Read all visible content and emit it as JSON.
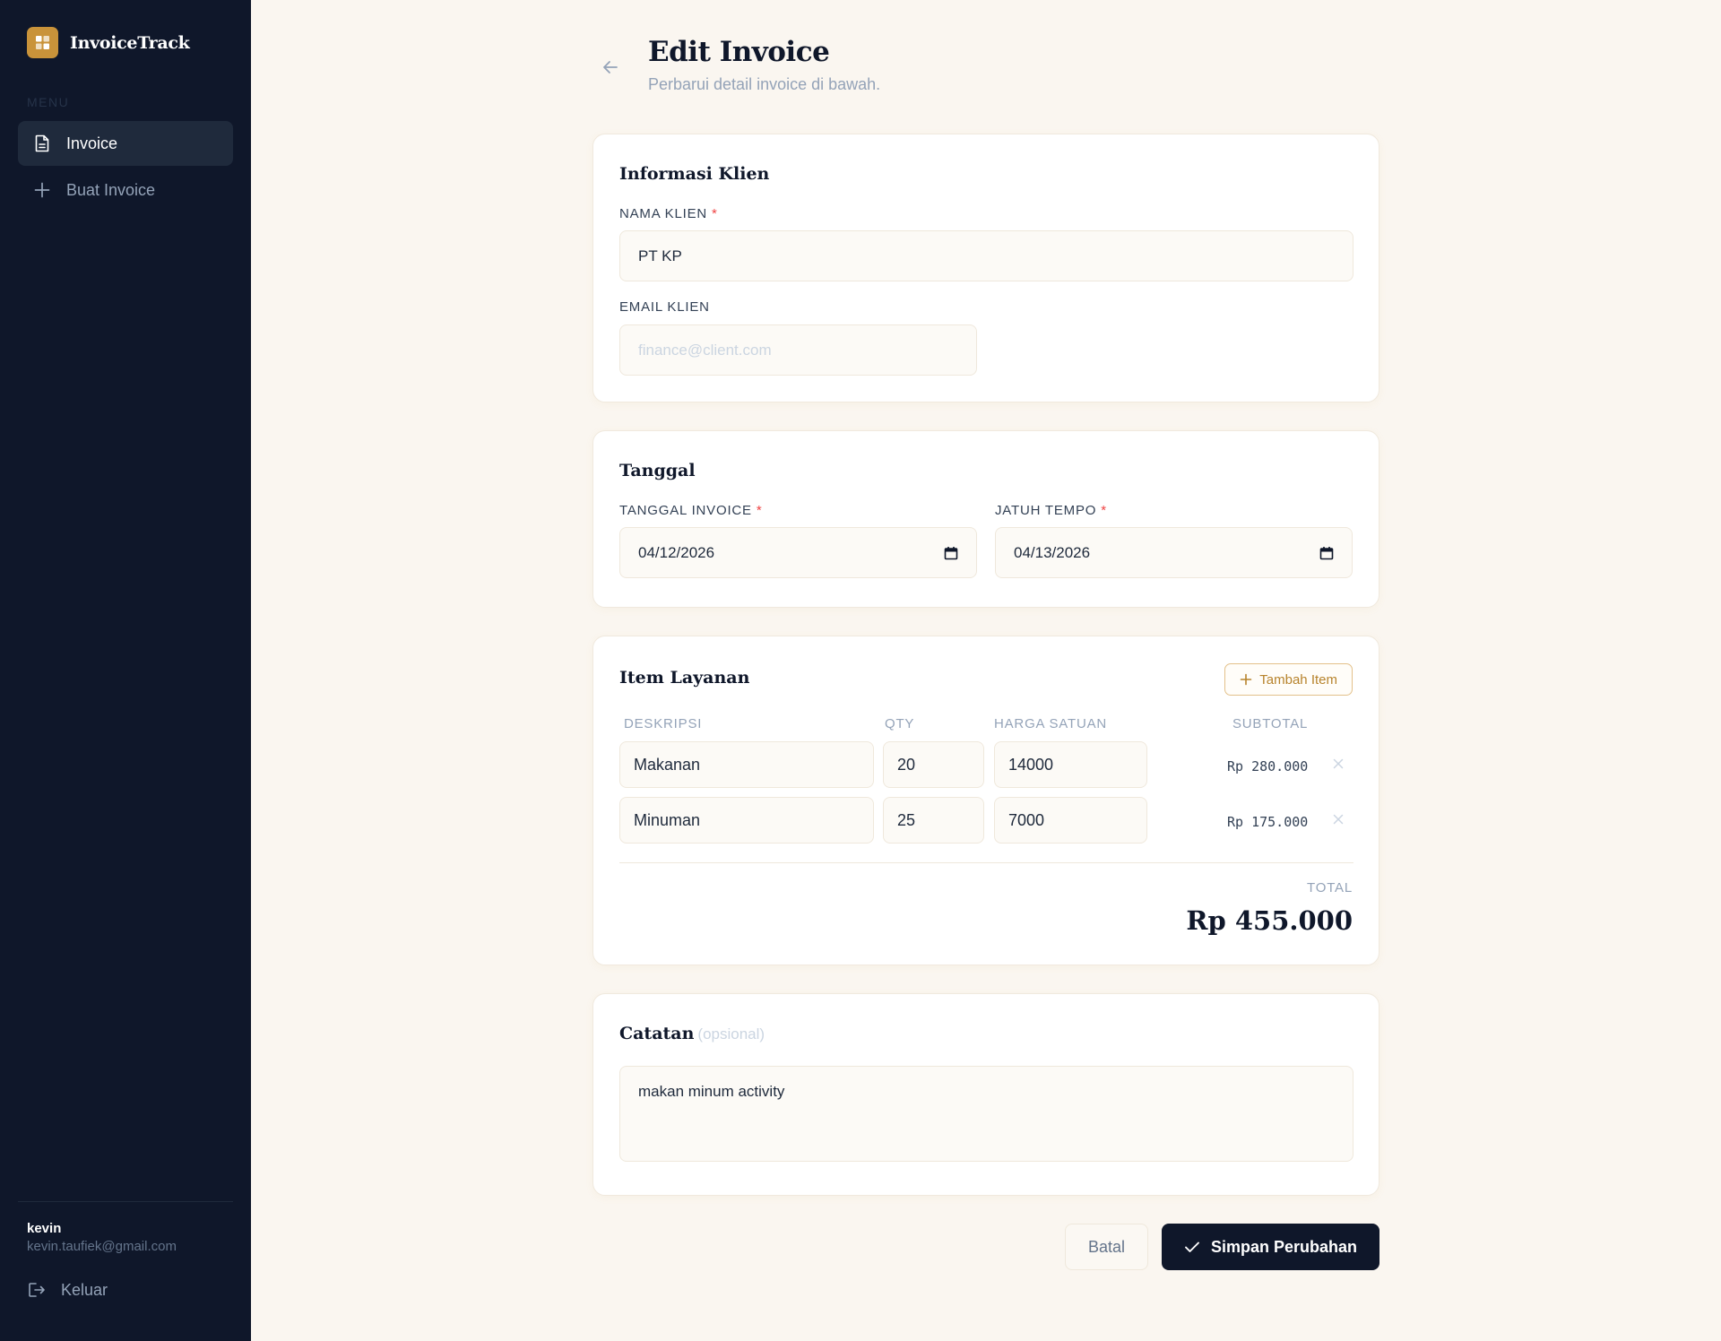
{
  "app": {
    "name": "InvoiceTrack",
    "accent": "#c9933a",
    "sidebar_bg": "#0f172a",
    "page_bg": "#faf6f0"
  },
  "sidebar": {
    "menu_label": "MENU",
    "items": [
      {
        "label": "Invoice",
        "icon": "document-icon",
        "active": true
      },
      {
        "label": "Buat Invoice",
        "icon": "plus-icon",
        "active": false
      }
    ],
    "user": {
      "name": "kevin",
      "email": "kevin.taufiek@gmail.com"
    },
    "logout_label": "Keluar"
  },
  "header": {
    "title": "Edit Invoice",
    "subtitle": "Perbarui detail invoice di bawah."
  },
  "client": {
    "title": "Informasi Klien",
    "name_label": "NAMA KLIEN",
    "name_value": "PT KP",
    "email_label": "EMAIL KLIEN",
    "email_placeholder": "finance@client.com",
    "required_mark": "*"
  },
  "dates": {
    "title": "Tanggal",
    "invoice_label": "TANGGAL INVOICE",
    "invoice_value": "04/12/2026",
    "due_label": "JATUH TEMPO",
    "due_value": "04/13/2026",
    "required_mark": "*"
  },
  "items": {
    "title": "Item Layanan",
    "add_label": "Tambah Item",
    "columns": [
      "DESKRIPSI",
      "QTY",
      "HARGA SATUAN",
      "SUBTOTAL"
    ],
    "rows": [
      {
        "description": "Makanan",
        "qty": "20",
        "price": "14000",
        "subtotal": "Rp 280.000"
      },
      {
        "description": "Minuman",
        "qty": "25",
        "price": "7000",
        "subtotal": "Rp 175.000"
      }
    ],
    "total_label": "TOTAL",
    "total_value": "Rp 455.000"
  },
  "notes": {
    "title": "Catatan",
    "optional": "(opsional)",
    "value": "makan minum activity"
  },
  "actions": {
    "cancel_label": "Batal",
    "save_label": "Simpan Perubahan"
  }
}
